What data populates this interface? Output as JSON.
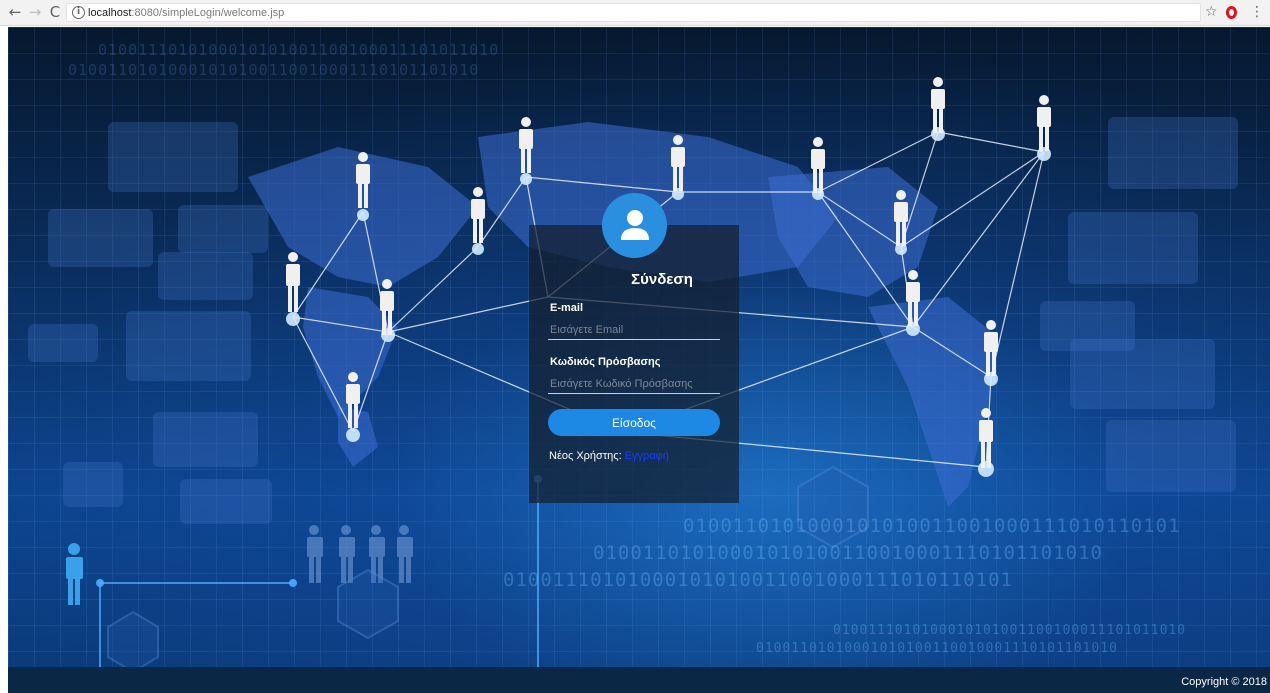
{
  "browser": {
    "back_icon": "back-arrow-icon",
    "forward_icon": "forward-arrow-icon",
    "reload_icon": "reload-icon",
    "url_host": "localhost",
    "url_rest": ":8080/simpleLogin/welcome.jsp",
    "bookmark_icon": "star-icon",
    "extension_icon": "opera-icon",
    "menu_icon": "kebab-menu-icon"
  },
  "background": {
    "binary_strings": [
      "0100111010100010101001100100011101011010",
      "01001101010001010100110010001110101101010",
      "01001110101000101010011001000111010110101",
      "0100110101000101010011001000111010110101",
      "01001101010001010100110010001110101101010"
    ]
  },
  "login": {
    "avatar_icon": "user-icon",
    "title": "Σύνδεση",
    "email_label": "E-mail",
    "email_placeholder": "Εισάγετε Email",
    "email_value": "",
    "password_label": "Κωδικός Πρόσβασης",
    "password_placeholder": "Εισάγετε Κωδικό Πρόσβασης",
    "password_value": "",
    "submit_label": "Είσοδος",
    "signup_prompt": "Νέος Χρήστης:",
    "signup_link": "Εγγραφή"
  },
  "footer": {
    "copyright": "Copyright © 2018"
  },
  "colors": {
    "accent": "#1e88e5",
    "card_background": "#141e2d",
    "link": "#1a3cff",
    "page_background": "#0a2d5c"
  }
}
